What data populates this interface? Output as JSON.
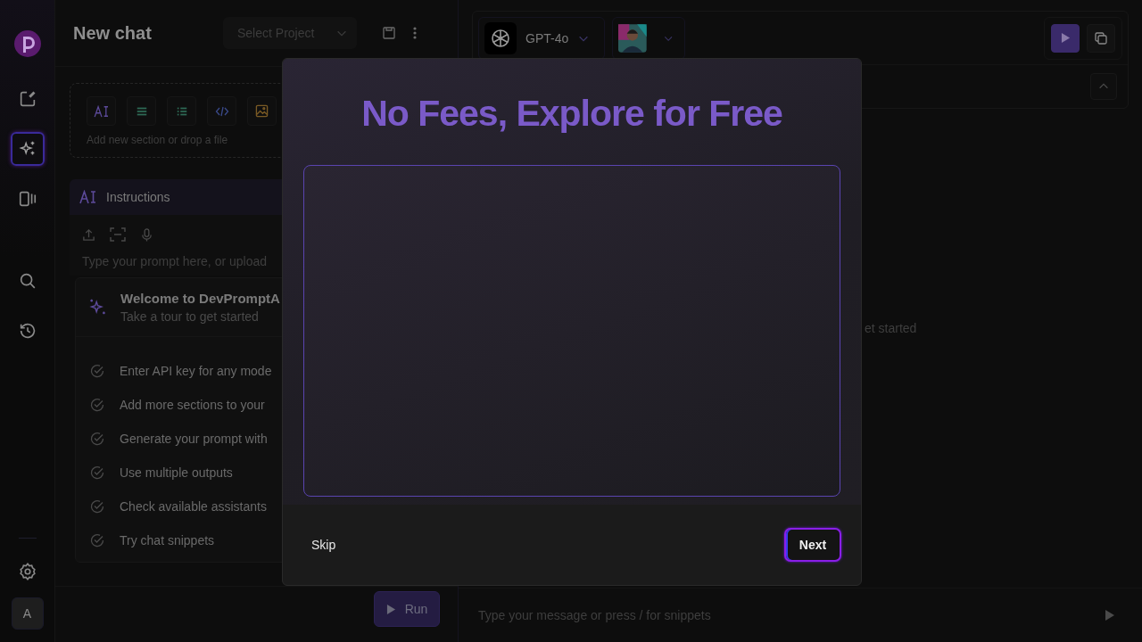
{
  "sidebar": {
    "nav": [
      {
        "kind": "edit",
        "selected": false
      },
      {
        "kind": "sparkle",
        "selected": true
      },
      {
        "kind": "panels",
        "selected": false
      },
      {
        "kind": "search",
        "selected": false
      },
      {
        "kind": "history",
        "selected": false
      }
    ],
    "avatar": "A"
  },
  "header": {
    "title": "New chat",
    "project_placeholder": "Select Project"
  },
  "sections": {
    "hint": "Add new section or drop a file"
  },
  "instructions": {
    "title": "Instructions",
    "placeholder": "Type your prompt here, or upload"
  },
  "tour": {
    "title": "Welcome to DevPromptA",
    "subtitle": "Take a tour to get started",
    "steps": [
      {
        "label": "Enter API key for any mode"
      },
      {
        "label": "Add more sections to your"
      },
      {
        "label": "Generate your prompt with"
      },
      {
        "label": "Use multiple outputs"
      },
      {
        "label": "Check available assistants"
      },
      {
        "label": "Try chat snippets"
      }
    ]
  },
  "run_button": "Run",
  "model": {
    "name": "GPT-4o"
  },
  "output": {
    "hint": "et started"
  },
  "message": {
    "placeholder": "Type your message or press / for snippets"
  },
  "dialog": {
    "title": "No Fees, Explore for Free",
    "skip": "Skip",
    "next": "Next"
  }
}
